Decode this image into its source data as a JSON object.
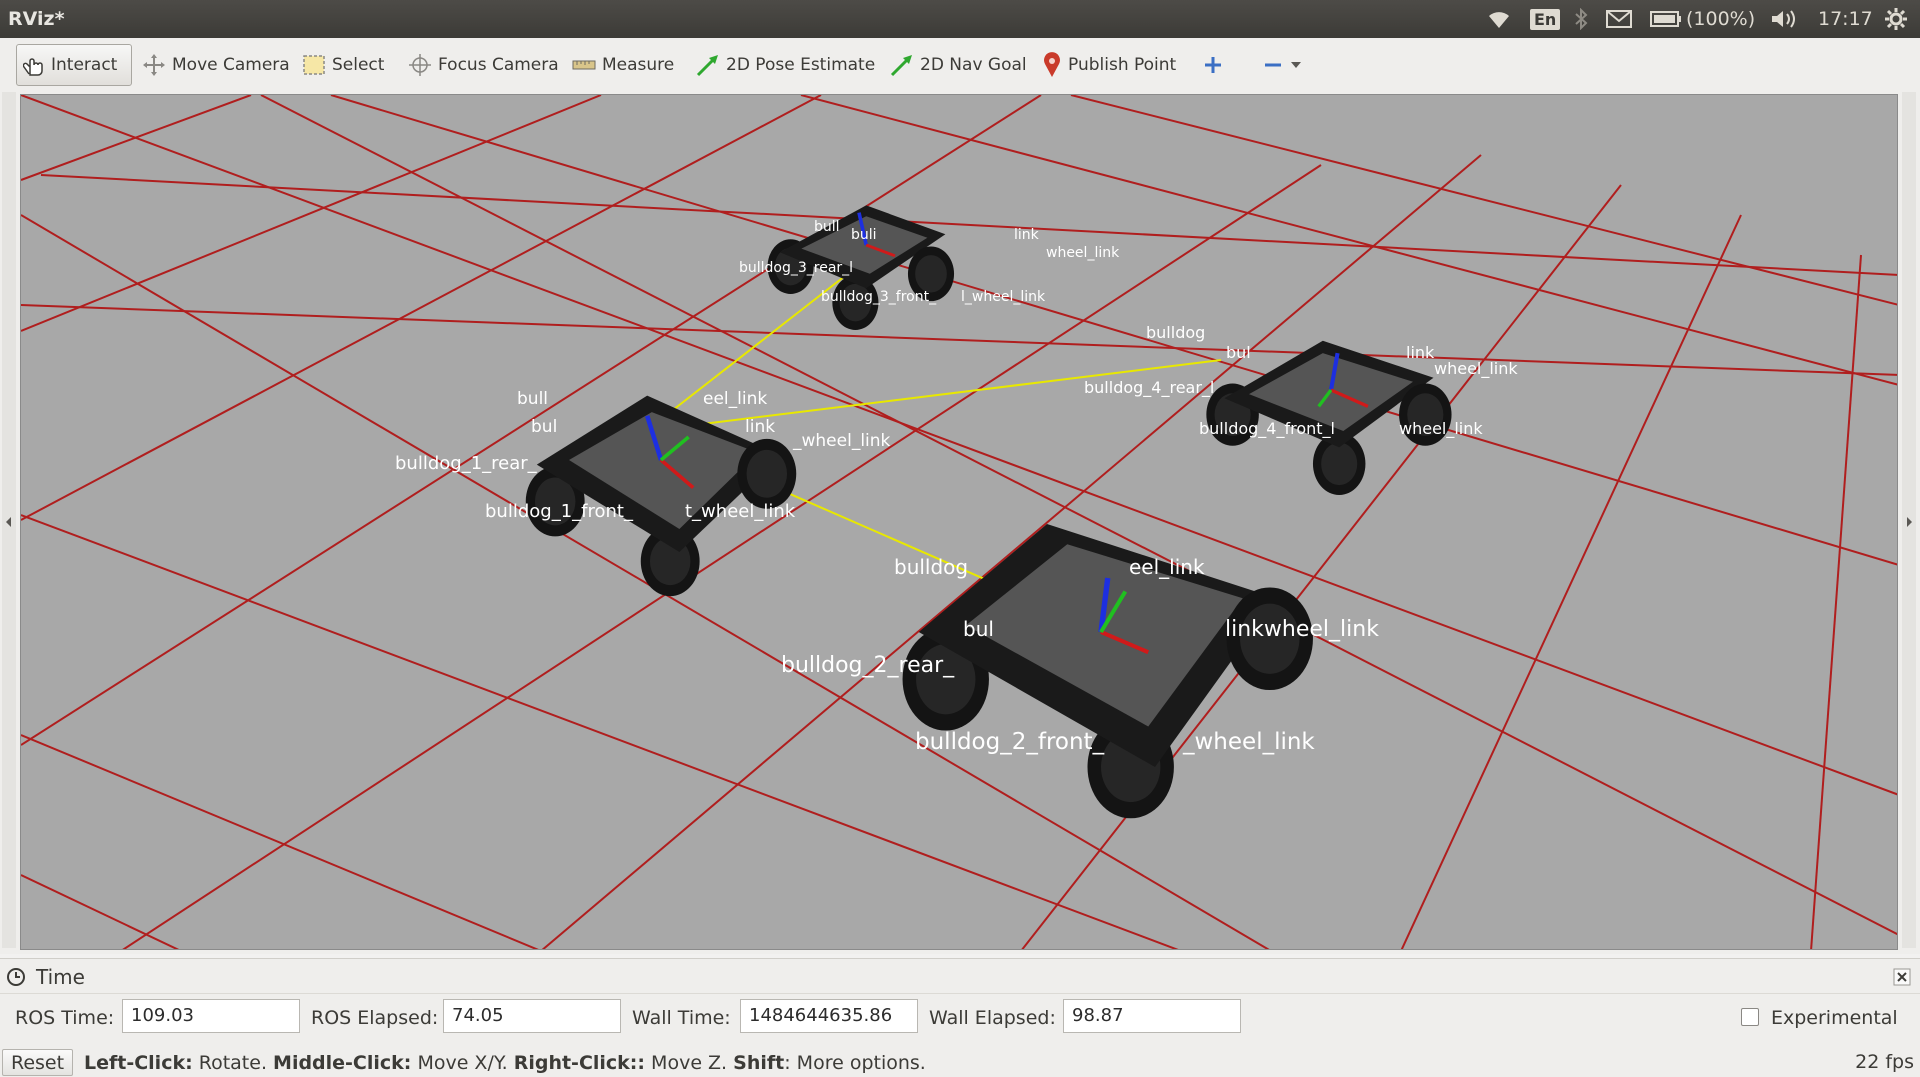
{
  "window": {
    "title": "RViz*"
  },
  "tray": {
    "lang": "En",
    "battery": "(100%)",
    "clock": "17:17"
  },
  "toolbar": {
    "interact": "Interact",
    "move_camera": "Move Camera",
    "select": "Select",
    "focus_camera": "Focus Camera",
    "measure": "Measure",
    "pose_estimate": "2D Pose Estimate",
    "nav_goal": "2D Nav Goal",
    "publish_point": "Publish Point"
  },
  "viewport": {
    "labels": {
      "r3_a": "bull",
      "r3_b": "buli",
      "r3_c": "link",
      "r3_d": "wheel_link",
      "r3_e": "bulldog_3_rear_l",
      "r3_f": "bulldog_3_front_",
      "r3_g": "l_wheel_link",
      "r4_a": "bulldog",
      "r4_b": "bul",
      "r4_c": "link",
      "r4_d": "wheel_link",
      "r4_e": "bulldog_4_rear_l",
      "r4_f": "bulldog_4_front_l",
      "r4_g": "wheel_link",
      "r1_a": "bull",
      "r1_b": "bul",
      "r1_c": "eel_link",
      "r1_d": "link",
      "r1_e": "_wheel_link",
      "r1_f": "bulldog_1_rear_",
      "r1_g": "bulldog_1_front_",
      "r1_h": "t_wheel_link",
      "r2_a": "bulldog",
      "r2_b": "eel_link",
      "r2_c": "bul",
      "r2_d": "linkwheel_link",
      "r2_e": "bulldog_2_rear_",
      "r2_f": "bulldog_2_front_",
      "r2_g": "_wheel_link"
    }
  },
  "time_panel": {
    "title": "Time",
    "ros_time_label": "ROS Time:",
    "ros_time": "109.03",
    "ros_elapsed_label": "ROS Elapsed:",
    "ros_elapsed": "74.05",
    "wall_time_label": "Wall Time:",
    "wall_time": "1484644635.86",
    "wall_elapsed_label": "Wall Elapsed:",
    "wall_elapsed": "98.87",
    "experimental_label": "Experimental"
  },
  "status": {
    "reset": "Reset",
    "hint_1_b": "Left-Click:",
    "hint_1": " Rotate. ",
    "hint_2_b": "Middle-Click:",
    "hint_2": " Move X/Y. ",
    "hint_3_b": "Right-Click::",
    "hint_3": " Move Z. ",
    "hint_4_b": "Shift",
    "hint_4": ": More options.",
    "fps": "22 fps"
  },
  "colors": {
    "grid": "#b01e1e",
    "floor": "#a8a8a8",
    "link": "#e8e800"
  }
}
